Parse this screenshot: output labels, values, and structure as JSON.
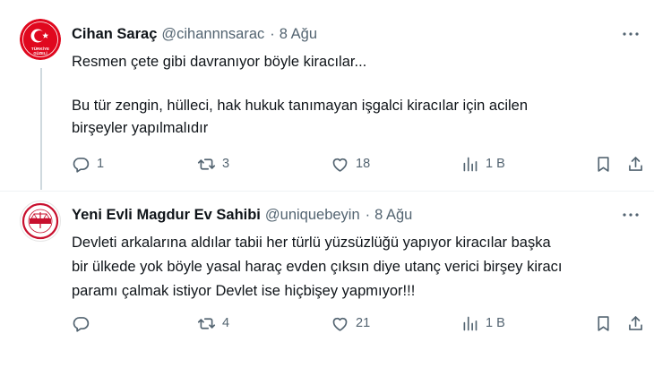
{
  "tweets": [
    {
      "author_name": "Cihan Saraç",
      "handle": "@cihannnsarac",
      "separator": "·",
      "date": "8 Ağu",
      "text_lines": [
        "Resmen çete gibi davranıyor böyle kiracılar...",
        "Bu tür zengin, hülleci, hak hukuk tanımayan işgalci kiracılar için acilen",
        "birşeyler yapılmalıdır"
      ],
      "avatar_text": [
        "TÜRKİYE",
        "GÜZELİ"
      ],
      "avatar_color": "#e0081e",
      "replies": "1",
      "retweets": "3",
      "likes": "18",
      "views": "1 B"
    },
    {
      "author_name": "Yeni Evli Magdur Ev Sahibi",
      "handle": "@uniquebeyin",
      "separator": "·",
      "date": "8 Ağu",
      "text_lines": [
        "Devleti arkalarına aldılar tabii her türlü yüzsüzlüğü yapıyor kiracılar başka",
        "bir ülkede yok böyle yasal haraç evden çıksın diye utanç verici birşey kiracı",
        "paramı çalmak istiyor Devlet ise hiçbişey yapmıyor!!!"
      ],
      "avatar_color": "#c8102e",
      "replies": "",
      "retweets": "4",
      "likes": "21",
      "views": "1 B"
    }
  ],
  "icons": {
    "more": "more-dots-icon",
    "reply": "reply-icon",
    "retweet": "retweet-icon",
    "like": "heart-icon",
    "views": "views-chart-icon",
    "bookmark": "bookmark-icon",
    "share": "share-icon"
  },
  "colors": {
    "text_primary": "#0f1419",
    "text_secondary": "#536471",
    "divider": "#eff3f4",
    "thread_line": "#cfd9de"
  }
}
